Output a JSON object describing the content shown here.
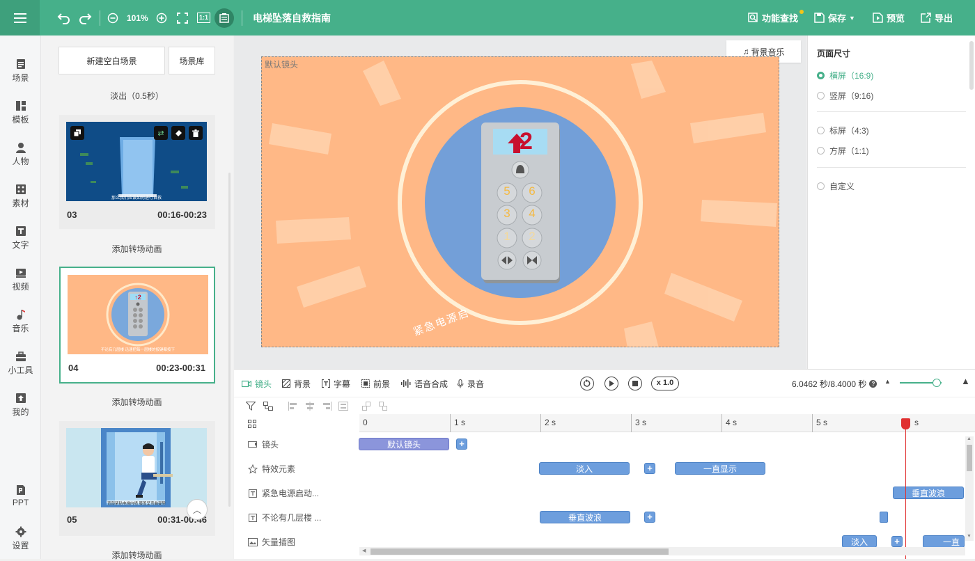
{
  "topbar": {
    "zoom": "101%",
    "doc_title": "电梯坠落自救指南",
    "fit_label": "1:1",
    "feature_search": "功能查找",
    "save": "保存",
    "preview": "预览",
    "export": "导出"
  },
  "sidebar": {
    "items": [
      {
        "label": "场景",
        "icon": "scene-icon"
      },
      {
        "label": "模板",
        "icon": "template-icon"
      },
      {
        "label": "人物",
        "icon": "person-icon"
      },
      {
        "label": "素材",
        "icon": "material-icon"
      },
      {
        "label": "文字",
        "icon": "text-icon"
      },
      {
        "label": "视频",
        "icon": "video-icon"
      },
      {
        "label": "音乐",
        "icon": "music-icon"
      },
      {
        "label": "小工具",
        "icon": "toolbox-icon"
      },
      {
        "label": "我的",
        "icon": "upload-icon"
      }
    ],
    "bottom": [
      {
        "label": "PPT",
        "icon": "ppt-icon"
      },
      {
        "label": "设置",
        "icon": "gear-icon"
      }
    ]
  },
  "scenes": {
    "new_blank": "新建空白场景",
    "library": "场景库",
    "fade_out": "淡出（0.5秒）",
    "add_transition": "添加转场动画",
    "cards": [
      {
        "num": "03",
        "time": "00:16-00:23",
        "caption": "那么我们应该如何进行自救"
      },
      {
        "num": "04",
        "time": "00:23-00:31",
        "caption": "不论有几层楼 迅速把每一层楼的按键都按下"
      },
      {
        "num": "05",
        "time": "00:31-00:46",
        "caption": "背部紧贴电梯内墙 膝盖呈弯曲姿势"
      }
    ]
  },
  "stage": {
    "camera_label": "默认镜头",
    "bg_music": "背景音乐",
    "display_floor": "2",
    "floor_buttons": [
      "5",
      "6",
      "3",
      "4",
      "1",
      "2"
    ],
    "emergency_text": "紧急电源启"
  },
  "page_size": {
    "title": "页面尺寸",
    "options": [
      {
        "label": "横屏（16:9)",
        "selected": true
      },
      {
        "label": "竖屏（9:16)",
        "selected": false
      },
      {
        "label": "标屏（4:3)",
        "selected": false
      },
      {
        "label": "方屏（1:1)",
        "selected": false
      },
      {
        "label": "自定义",
        "selected": false
      }
    ]
  },
  "timeline": {
    "tabs": [
      "镜头",
      "背景",
      "字幕",
      "前景",
      "语音合成",
      "录音"
    ],
    "speed": "x 1.0",
    "time_readout": "6.0462 秒/8.4000 秒",
    "ticks": [
      "0",
      "1 s",
      "2 s",
      "3 s",
      "4 s",
      "5 s",
      "s"
    ],
    "playhead_seconds": 6.0462,
    "tracks": [
      {
        "label": "镜头",
        "icon": "camera-track-icon"
      },
      {
        "label": "特效元素",
        "icon": "effect-icon"
      },
      {
        "label": "紧急电源启动...",
        "icon": "text-track-icon"
      },
      {
        "label": "不论有几层楼 ...",
        "icon": "text-track-icon"
      },
      {
        "label": "矢量插图",
        "icon": "illustration-icon"
      }
    ],
    "clips": {
      "camera": "默认镜头",
      "fade_in": "淡入",
      "always_show": "一直显示",
      "vertical_wave": "垂直波浪",
      "vertical_wave_2": "垂直波浪",
      "fade_in_2": "淡入",
      "cut_off": "一直"
    }
  },
  "colors": {
    "brand": "#46b08a",
    "stage_bg": "#ffb886",
    "clip_blue": "#6d9edd",
    "playhead": "#e03030"
  }
}
